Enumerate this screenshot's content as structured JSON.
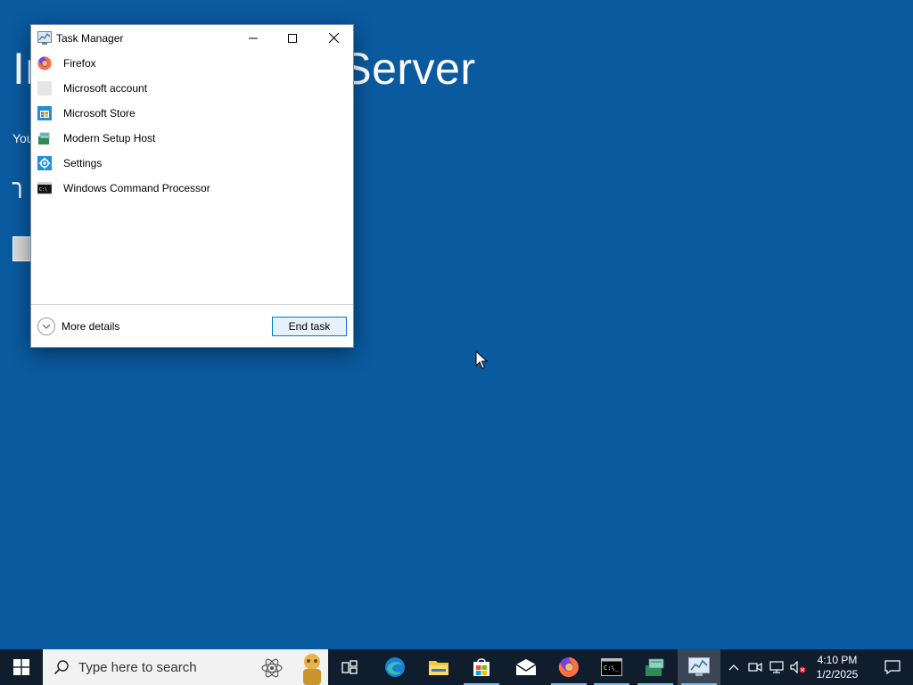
{
  "background": {
    "title": "Install Windows Server",
    "subtext": "You",
    "spinner": "╮"
  },
  "task_manager": {
    "title": "Task Manager",
    "processes": [
      {
        "label": "Firefox",
        "icon": "firefox-icon"
      },
      {
        "label": "Microsoft account",
        "icon": "microsoft-account-icon"
      },
      {
        "label": "Microsoft Store",
        "icon": "microsoft-store-icon"
      },
      {
        "label": "Modern Setup Host",
        "icon": "setup-host-icon"
      },
      {
        "label": "Settings",
        "icon": "settings-gear-icon"
      },
      {
        "label": "Windows Command Processor",
        "icon": "cmd-icon"
      }
    ],
    "more_details_label": "More details",
    "end_task_label": "End task"
  },
  "taskbar": {
    "search_placeholder": "Type here to search",
    "apps": [
      "task-view",
      "edge",
      "file-explorer",
      "microsoft-store",
      "mail",
      "firefox",
      "command-prompt",
      "setup-host",
      "task-manager"
    ],
    "clock_time": "4:10 PM",
    "clock_date": "1/2/2025"
  },
  "colors": {
    "desktop_bg": "#0a5aa0",
    "taskbar_bg": "#101d2c",
    "accent": "#0078d7"
  }
}
